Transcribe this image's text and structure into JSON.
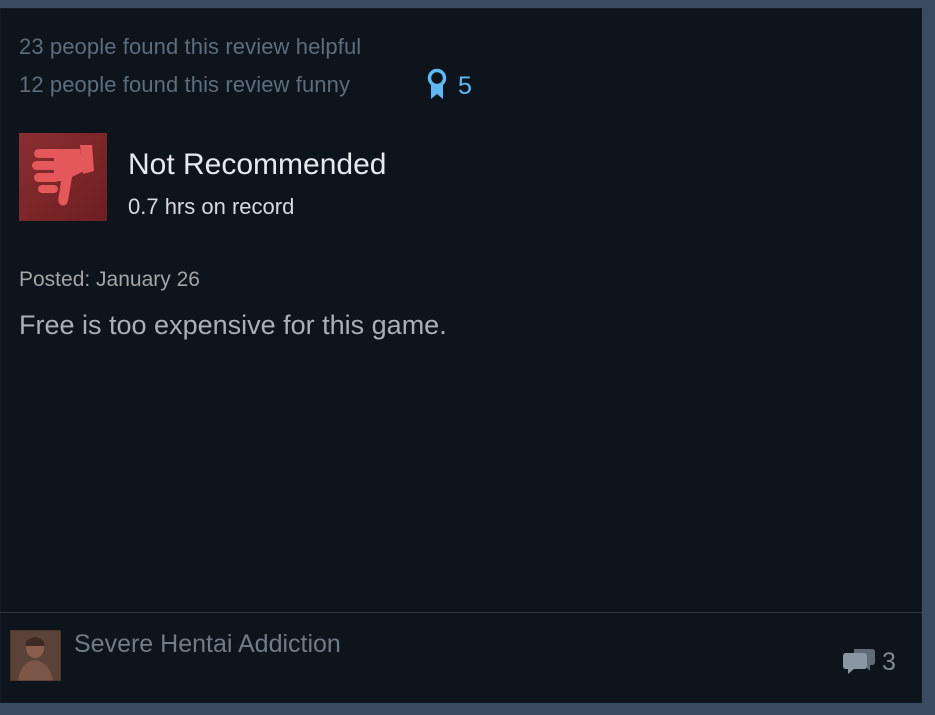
{
  "review": {
    "helpful_text": "23 people found this review helpful",
    "funny_text": "12 people found this review funny",
    "award_count": "5",
    "recommendation": "Not Recommended",
    "hours": "0.7 hrs on record",
    "posted": "Posted: January 26",
    "text": "Free is too expensive for this game.",
    "thumb_icon": "thumbs-down-icon",
    "award_icon": "award-ribbon-icon"
  },
  "author": {
    "name": "Severe Hentai Addiction",
    "avatar_icon": "avatar-image"
  },
  "comments": {
    "count": "3",
    "icon": "comment-bubbles-icon"
  },
  "colors": {
    "card_bg": "#0e141b",
    "award_blue": "#5eb9f5",
    "thumb_bg": "#7b2629",
    "thumb_icon": "#e4585b"
  }
}
